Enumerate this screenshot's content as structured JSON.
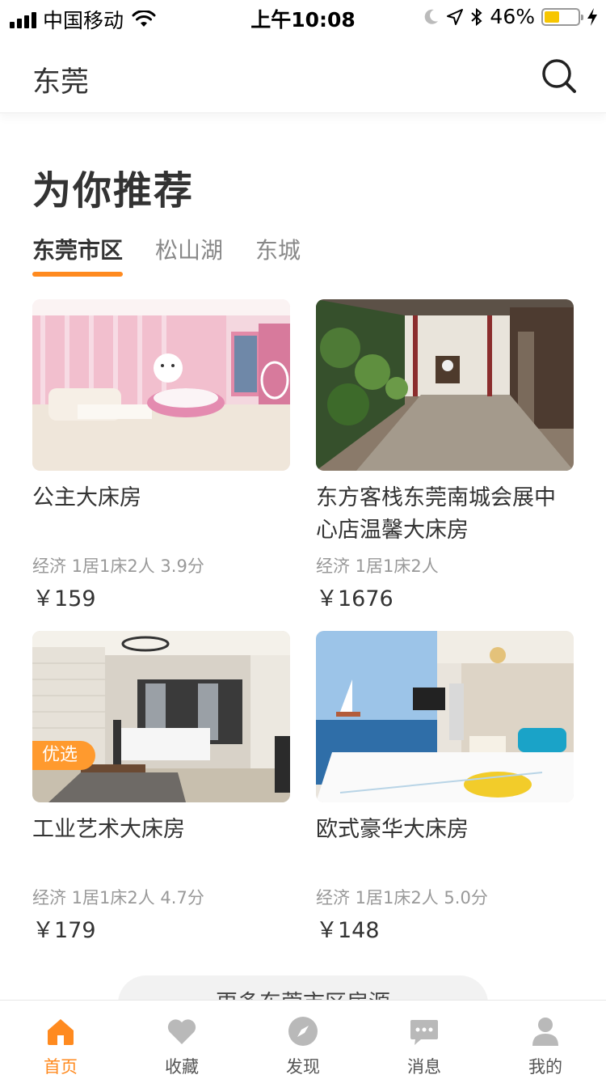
{
  "status_bar": {
    "carrier": "中国移动",
    "time": "上午10:08",
    "battery": "46%",
    "battery_level": 0.46
  },
  "nav": {
    "city": "东莞",
    "search_icon": "search-icon"
  },
  "section": {
    "title": "为你推荐",
    "tabs": [
      {
        "label": "东莞市区",
        "active": true
      },
      {
        "label": "松山湖",
        "active": false
      },
      {
        "label": "东城",
        "active": false
      }
    ]
  },
  "listings": [
    {
      "name": "公主大床房",
      "meta": "经济 1居1床2人 3.9分",
      "price": "￥159",
      "badge": ""
    },
    {
      "name": " 东方客栈东莞南城会展中心店温馨大床房",
      "meta": "经济 1居1床2人",
      "price": "￥1676",
      "badge": ""
    },
    {
      "name": "工业艺术大床房",
      "meta": "经济 1居1床2人 4.7分",
      "price": "￥179",
      "badge": "优选"
    },
    {
      "name": "欧式豪华大床房",
      "meta": "经济 1居1床2人 5.0分",
      "price": "￥148",
      "badge": ""
    }
  ],
  "more_button": "更多东莞市区房源",
  "tab_bar": [
    {
      "label": "首页",
      "icon": "home-icon",
      "active": true
    },
    {
      "label": "收藏",
      "icon": "heart-icon",
      "active": false
    },
    {
      "label": "发现",
      "icon": "compass-icon",
      "active": false
    },
    {
      "label": "消息",
      "icon": "message-icon",
      "active": false
    },
    {
      "label": "我的",
      "icon": "user-icon",
      "active": false
    }
  ],
  "colors": {
    "accent": "#ff8a1f",
    "badge": "#ff9a2e",
    "text": "#333333",
    "muted": "#999999"
  }
}
